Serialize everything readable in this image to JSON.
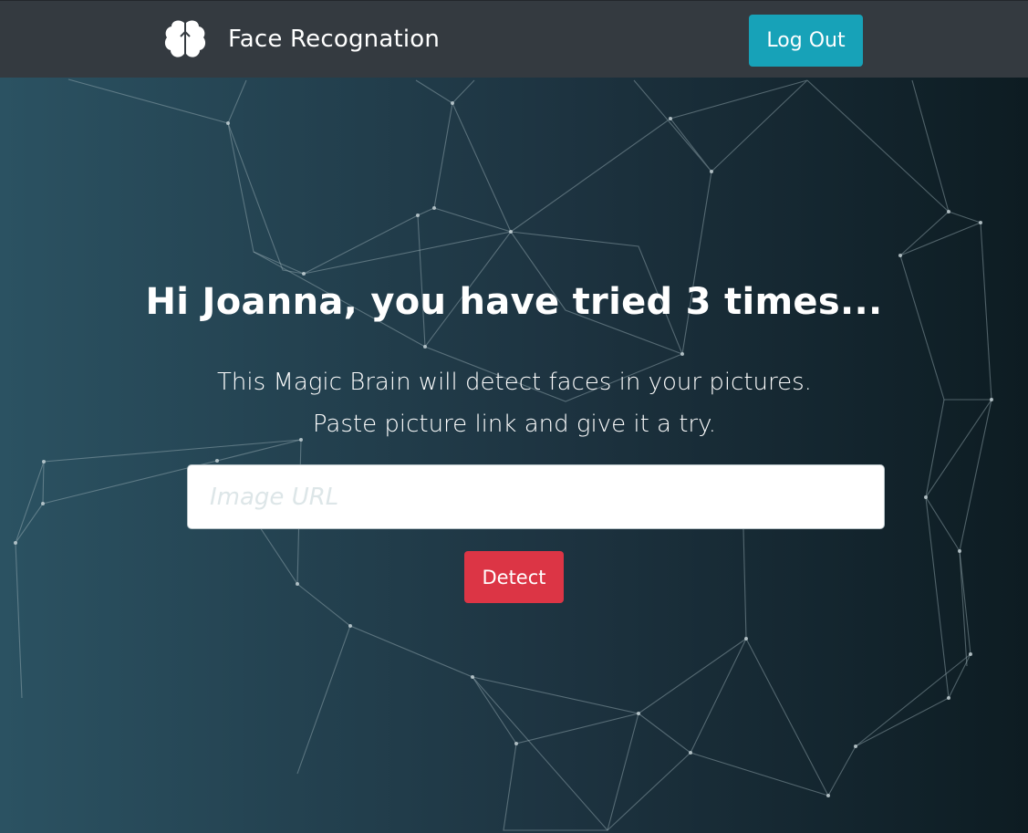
{
  "navbar": {
    "brand_title": "Face Recognation",
    "brand_icon": "brain-icon",
    "logout_label": "Log Out"
  },
  "main": {
    "greeting": "Hi Joanna, you have tried 3 times...",
    "intro": "This Magic Brain will detect faces in your pictures. Paste picture link and give it a try.",
    "url_input": {
      "placeholder": "Image URL",
      "value": ""
    },
    "detect_label": "Detect"
  },
  "colors": {
    "navbar_bg": "#343a40",
    "logout_button": "#17a2b8",
    "detect_button": "#dc3545",
    "background_start": "#2b5262",
    "background_end": "#0d1c22"
  }
}
